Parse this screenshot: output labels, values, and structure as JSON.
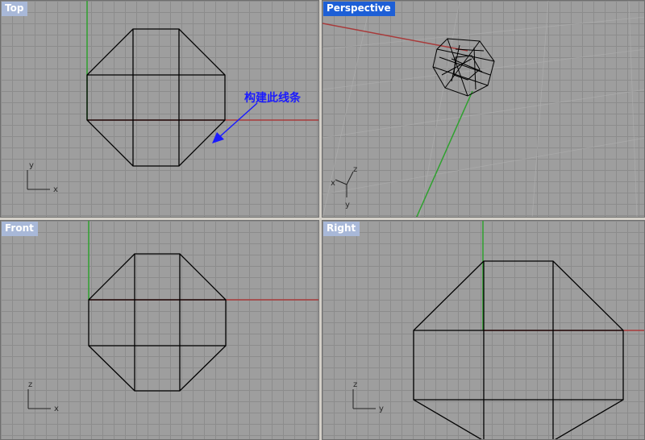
{
  "viewports": {
    "top": {
      "label": "Top"
    },
    "perspective": {
      "label": "Perspective"
    },
    "front": {
      "label": "Front"
    },
    "right": {
      "label": "Right"
    }
  },
  "axes": {
    "top": {
      "x": "x",
      "y": "y"
    },
    "perspective": {
      "x": "x",
      "y": "y",
      "z": "z"
    },
    "front": {
      "x": "x",
      "z": "z"
    },
    "right": {
      "y": "y",
      "z": "z"
    }
  },
  "annotation": {
    "text": "构建此线条"
  },
  "colors": {
    "grid_bg": "#9e9e9e",
    "x_axis": "#a83a3a",
    "y_axis": "#2fa12f",
    "active_label": "#1d5fd6",
    "annotation": "#1a1aff"
  }
}
